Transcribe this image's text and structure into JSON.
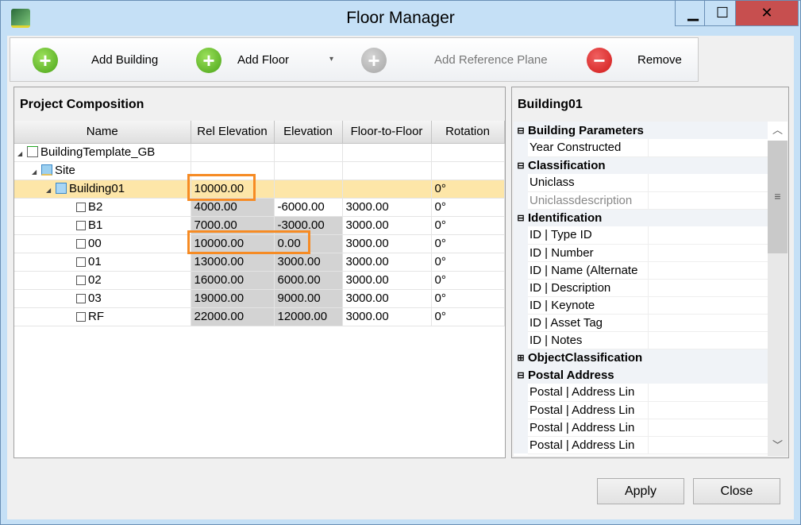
{
  "window": {
    "title": "Floor Manager",
    "minimize": "▁",
    "maximize": "☐",
    "close": "✕"
  },
  "toolbar": {
    "add_building": "Add Building",
    "add_floor": "Add Floor",
    "add_floor_menu": "▾",
    "add_reference_plane": "Add Reference Plane",
    "remove": "Remove"
  },
  "composition": {
    "title": "Project Composition",
    "columns": [
      "Name",
      "Rel Elevation",
      "Elevation",
      "Floor-to-Floor",
      "Rotation"
    ],
    "rows": [
      {
        "name": "BuildingTemplate_GB",
        "rel": "",
        "elev": "",
        "f2f": "",
        "rot": ""
      },
      {
        "name": "Site",
        "rel": "",
        "elev": "",
        "f2f": "",
        "rot": ""
      },
      {
        "name": "Building01",
        "rel": "10000.00",
        "elev": "",
        "f2f": "",
        "rot": "0°"
      },
      {
        "name": "B2",
        "rel": "4000.00",
        "elev": "-6000.00",
        "f2f": "3000.00",
        "rot": "0°"
      },
      {
        "name": "B1",
        "rel": "7000.00",
        "elev": "-3000.00",
        "f2f": "3000.00",
        "rot": "0°"
      },
      {
        "name": "00",
        "rel": "10000.00",
        "elev": "0.00",
        "f2f": "3000.00",
        "rot": "0°"
      },
      {
        "name": "01",
        "rel": "13000.00",
        "elev": "3000.00",
        "f2f": "3000.00",
        "rot": "0°"
      },
      {
        "name": "02",
        "rel": "16000.00",
        "elev": "6000.00",
        "f2f": "3000.00",
        "rot": "0°"
      },
      {
        "name": "03",
        "rel": "19000.00",
        "elev": "9000.00",
        "f2f": "3000.00",
        "rot": "0°"
      },
      {
        "name": "RF",
        "rel": "22000.00",
        "elev": "12000.00",
        "f2f": "3000.00",
        "rot": "0°"
      }
    ]
  },
  "properties": {
    "title": "Building01",
    "expanded": "⊟",
    "collapsed": "⊞",
    "rows": [
      {
        "cat": "Building Parameters"
      },
      {
        "name": "Year Constructed"
      },
      {
        "cat": "Classification"
      },
      {
        "name": "Uniclass"
      },
      {
        "name": "Uniclassdescription",
        "dim": true
      },
      {
        "cat": "Identification"
      },
      {
        "name": "ID | Type ID"
      },
      {
        "name": "ID | Number"
      },
      {
        "name": "ID | Name (Alternate"
      },
      {
        "name": "ID | Description"
      },
      {
        "name": "ID | Keynote"
      },
      {
        "name": "ID | Asset Tag"
      },
      {
        "name": "ID | Notes"
      },
      {
        "cat": "ObjectClassification",
        "closed": true
      },
      {
        "cat": "Postal Address"
      },
      {
        "name": "Postal | Address Lin"
      },
      {
        "name": "Postal | Address Lin"
      },
      {
        "name": "Postal | Address Lin"
      },
      {
        "name": "Postal | Address Lin"
      }
    ]
  },
  "buttons": {
    "apply": "Apply",
    "close": "Close"
  }
}
